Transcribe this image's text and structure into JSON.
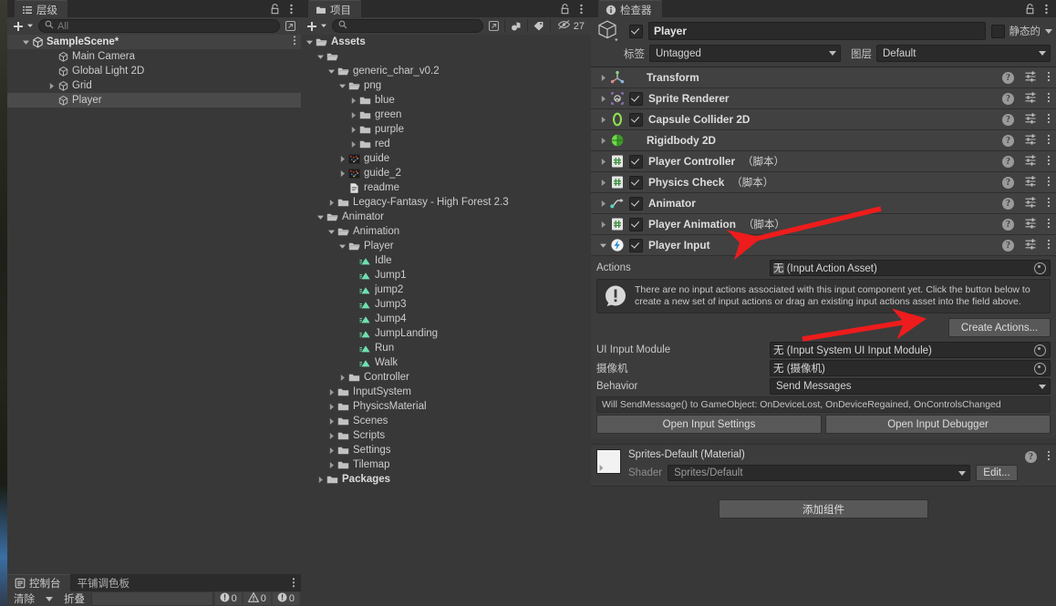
{
  "hierarchy": {
    "tab_label": "层级",
    "tab_icon": "hierarchy-icon",
    "toolbar": {
      "add_label": "+",
      "search_placeholder": "All",
      "search_value": ""
    },
    "items": [
      {
        "label": "SampleScene*",
        "icon": "unity-scene-icon",
        "depth": 0,
        "twisty": "down",
        "bold": true,
        "selected": false
      },
      {
        "label": "Main Camera",
        "icon": "gameobject-icon",
        "depth": 2,
        "twisty": "none",
        "bold": false,
        "selected": false
      },
      {
        "label": "Global Light 2D",
        "icon": "gameobject-icon",
        "depth": 2,
        "twisty": "none",
        "bold": false,
        "selected": false
      },
      {
        "label": "Grid",
        "icon": "gameobject-icon",
        "depth": 2,
        "twisty": "right",
        "bold": false,
        "selected": false
      },
      {
        "label": "Player",
        "icon": "gameobject-icon",
        "depth": 2,
        "twisty": "none",
        "bold": false,
        "selected": true
      }
    ]
  },
  "project": {
    "tab_label": "项目",
    "tab_icon": "folder-icon",
    "toolbar": {
      "add_label": "+",
      "search_placeholder": "",
      "search_value": "",
      "hidden_count": "27"
    },
    "items": [
      {
        "label": "Assets",
        "icon": "folder-open-icon",
        "depth": 0,
        "twisty": "down",
        "bold": true
      },
      {
        "label": "",
        "icon": "folder-open-icon",
        "depth": 1,
        "twisty": "down",
        "bold": false
      },
      {
        "label": "generic_char_v0.2",
        "icon": "folder-open-icon",
        "depth": 2,
        "twisty": "down",
        "bold": false
      },
      {
        "label": "png",
        "icon": "folder-open-icon",
        "depth": 3,
        "twisty": "down",
        "bold": false
      },
      {
        "label": "blue",
        "icon": "folder-icon",
        "depth": 4,
        "twisty": "right",
        "bold": false
      },
      {
        "label": "green",
        "icon": "folder-icon",
        "depth": 4,
        "twisty": "right",
        "bold": false
      },
      {
        "label": "purple",
        "icon": "folder-icon",
        "depth": 4,
        "twisty": "right",
        "bold": false
      },
      {
        "label": "red",
        "icon": "folder-icon",
        "depth": 4,
        "twisty": "right",
        "bold": false
      },
      {
        "label": "guide",
        "icon": "sprite-texture-icon",
        "depth": 3,
        "twisty": "right",
        "bold": false
      },
      {
        "label": "guide_2",
        "icon": "sprite-texture-icon",
        "depth": 3,
        "twisty": "right",
        "bold": false
      },
      {
        "label": "readme",
        "icon": "text-file-icon",
        "depth": 3,
        "twisty": "none",
        "bold": false
      },
      {
        "label": "Legacy-Fantasy - High Forest 2.3",
        "icon": "folder-icon",
        "depth": 2,
        "twisty": "right",
        "bold": false
      },
      {
        "label": "Animator",
        "icon": "folder-open-icon",
        "depth": 1,
        "twisty": "down",
        "bold": false
      },
      {
        "label": "Animation",
        "icon": "folder-open-icon",
        "depth": 2,
        "twisty": "down",
        "bold": false
      },
      {
        "label": "Player",
        "icon": "folder-open-icon",
        "depth": 3,
        "twisty": "down",
        "bold": false
      },
      {
        "label": "Idle",
        "icon": "animation-clip-icon",
        "depth": 4,
        "twisty": "none",
        "bold": false
      },
      {
        "label": "Jump1",
        "icon": "animation-clip-icon",
        "depth": 4,
        "twisty": "none",
        "bold": false
      },
      {
        "label": "jump2",
        "icon": "animation-clip-icon",
        "depth": 4,
        "twisty": "none",
        "bold": false
      },
      {
        "label": "Jump3",
        "icon": "animation-clip-icon",
        "depth": 4,
        "twisty": "none",
        "bold": false
      },
      {
        "label": "Jump4",
        "icon": "animation-clip-icon",
        "depth": 4,
        "twisty": "none",
        "bold": false
      },
      {
        "label": "JumpLanding",
        "icon": "animation-clip-icon",
        "depth": 4,
        "twisty": "none",
        "bold": false
      },
      {
        "label": "Run",
        "icon": "animation-clip-icon",
        "depth": 4,
        "twisty": "none",
        "bold": false
      },
      {
        "label": "Walk",
        "icon": "animation-clip-icon",
        "depth": 4,
        "twisty": "none",
        "bold": false
      },
      {
        "label": "Controller",
        "icon": "folder-icon",
        "depth": 3,
        "twisty": "right",
        "bold": false
      },
      {
        "label": "InputSystem",
        "icon": "folder-icon",
        "depth": 2,
        "twisty": "right",
        "bold": false
      },
      {
        "label": "PhysicsMaterial",
        "icon": "folder-icon",
        "depth": 2,
        "twisty": "right",
        "bold": false
      },
      {
        "label": "Scenes",
        "icon": "folder-icon",
        "depth": 2,
        "twisty": "right",
        "bold": false
      },
      {
        "label": "Scripts",
        "icon": "folder-icon",
        "depth": 2,
        "twisty": "right",
        "bold": false
      },
      {
        "label": "Settings",
        "icon": "folder-icon",
        "depth": 2,
        "twisty": "right",
        "bold": false
      },
      {
        "label": "Tilemap",
        "icon": "folder-icon",
        "depth": 2,
        "twisty": "right",
        "bold": false
      },
      {
        "label": "Packages",
        "icon": "folder-icon",
        "depth": 1,
        "twisty": "right",
        "bold": true
      }
    ]
  },
  "inspector": {
    "tab_label": "检查器",
    "tab_icon": "info-icon",
    "object": {
      "enabled": true,
      "name": "Player",
      "static_label": "静态的",
      "static_checked": false,
      "tag_label": "标签",
      "tag_value": "Untagged",
      "layer_label": "图层",
      "layer_value": "Default"
    },
    "components": [
      {
        "name": "Transform",
        "script_suffix": "",
        "icon": "transform-icon",
        "has_checkbox": false,
        "checked": false,
        "expanded": false
      },
      {
        "name": "Sprite Renderer",
        "script_suffix": "",
        "icon": "sprite-renderer-icon",
        "has_checkbox": true,
        "checked": true,
        "expanded": false
      },
      {
        "name": "Capsule Collider 2D",
        "script_suffix": "",
        "icon": "capsule-collider-icon",
        "has_checkbox": true,
        "checked": true,
        "expanded": false
      },
      {
        "name": "Rigidbody 2D",
        "script_suffix": "",
        "icon": "rigidbody-icon",
        "has_checkbox": false,
        "checked": false,
        "expanded": false
      },
      {
        "name": "Player Controller",
        "script_suffix": "（脚本）",
        "icon": "cs-script-icon",
        "has_checkbox": true,
        "checked": true,
        "expanded": false
      },
      {
        "name": "Physics Check",
        "script_suffix": "（脚本）",
        "icon": "cs-script-icon",
        "has_checkbox": true,
        "checked": true,
        "expanded": false
      },
      {
        "name": "Animator",
        "script_suffix": "",
        "icon": "animator-icon",
        "has_checkbox": true,
        "checked": true,
        "expanded": false
      },
      {
        "name": "Player Animation",
        "script_suffix": "（脚本）",
        "icon": "cs-script-icon",
        "has_checkbox": true,
        "checked": true,
        "expanded": false
      },
      {
        "name": "Player Input",
        "script_suffix": "",
        "icon": "player-input-icon",
        "has_checkbox": true,
        "checked": true,
        "expanded": true
      }
    ],
    "player_input": {
      "actions_label": "Actions",
      "actions_value": "无 (Input Action Asset)",
      "actions_value_prefix": "无",
      "help_text": "There are no input actions associated with this input component yet. Click the button below to create a new set of input actions or drag an existing input actions asset into the field above.",
      "create_actions_label": "Create Actions...",
      "ui_input_module_label": "UI Input Module",
      "ui_input_module_value": "无 (Input System UI Input Module)",
      "camera_label": "摄像机",
      "camera_value": "无 (摄像机)",
      "behavior_label": "Behavior",
      "behavior_value": "Send Messages",
      "behavior_info": "Will SendMessage() to GameObject: OnDeviceLost, OnDeviceRegained, OnControlsChanged",
      "open_input_settings_label": "Open Input Settings",
      "open_input_debugger_label": "Open Input Debugger"
    },
    "material": {
      "title": "Sprites-Default (Material)",
      "shader_label": "Shader",
      "shader_value": "Sprites/Default",
      "edit_label": "Edit...",
      "swatch_color": "#f2f2f2"
    },
    "add_component_label": "添加组件"
  },
  "console": {
    "tab_label": "控制台",
    "tab_icon": "console-icon",
    "secondary_tab_label": "平铺调色板",
    "clear_label": "清除",
    "collapse_label": "折叠",
    "error_count": "0",
    "warning_count": "0",
    "info_count": "0"
  },
  "colors": {
    "panel_bg": "#383838",
    "tab_bg": "#3c3c3c",
    "window_bg": "#2b2b2b",
    "component_header": "#414141",
    "selection": "#4a4a4a",
    "field_bg": "#2a2a2a",
    "accent_green": "#7ddb8e",
    "anim_icon": "#6fe0b0",
    "arrow_red": "#ee1c1c",
    "text": "#c4c4c4"
  }
}
